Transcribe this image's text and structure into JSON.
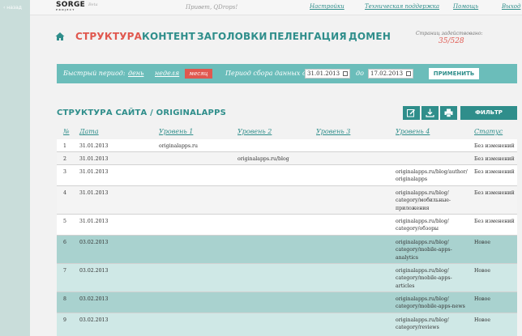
{
  "top": {
    "back_label": "‹ назад",
    "logo_main": "SORGE",
    "logo_sub": "PROJECT",
    "logo_tag": "Beta",
    "greeting": "Привет, QDrops!",
    "links": [
      "Настройки",
      "Техническая поддержка",
      "Помощь",
      "Выход"
    ]
  },
  "nav": {
    "items": [
      {
        "label": "СТРУКТУРА",
        "active": true
      },
      {
        "label": "КОНТЕНТ",
        "active": false
      },
      {
        "label": "ЗАГОЛОВКИ",
        "active": false
      },
      {
        "label": "ПЕЛЕНГАЦИЯ",
        "active": false
      },
      {
        "label": "ДОМЕН",
        "active": false
      }
    ],
    "counter_label": "Страниц задействовано:",
    "counter_value": "35/528"
  },
  "filter": {
    "quick_label": "Быстрый период:",
    "day": "день",
    "week": "неделя",
    "month": "месяц",
    "period_label": "Период сбора данных с",
    "date_from": "31.01.2013",
    "to_label": "до",
    "date_to": "17.02.2013",
    "apply_label": "ПРИМЕНИТЬ"
  },
  "section": {
    "title": "СТРУКТУРА САЙТА / ORIGINALAPPS",
    "filter_label": "ФИЛЬТР"
  },
  "table": {
    "columns": [
      "№",
      "Дата",
      "Уровень 1",
      "Уровень 2",
      "Уровень 3",
      "Уровень 4",
      "Статус"
    ],
    "rows": [
      {
        "num": "1",
        "date": "31.01.2013",
        "l1": "originalapps.ru",
        "l2": "",
        "l3": "",
        "l4": "",
        "status": "Без изменений"
      },
      {
        "num": "2",
        "date": "31.01.2013",
        "l1": "",
        "l2": "originalapps.ru/blog",
        "l3": "",
        "l4": "",
        "status": "Без изменений"
      },
      {
        "num": "3",
        "date": "31.01.2013",
        "l1": "",
        "l2": "",
        "l3": "",
        "l4": "originalapps.ru/blog/author/ originalapps",
        "status": "Без изменений"
      },
      {
        "num": "4",
        "date": "31.01.2013",
        "l1": "",
        "l2": "",
        "l3": "",
        "l4": "originalapps.ru/blog/ category/мобильные- приложения",
        "status": "Без изменений"
      },
      {
        "num": "5",
        "date": "31.01.2013",
        "l1": "",
        "l2": "",
        "l3": "",
        "l4": "originalapps.ru/blog/ category/обзоры",
        "status": "Без изменений"
      },
      {
        "num": "6",
        "date": "03.02.2013",
        "l1": "",
        "l2": "",
        "l3": "",
        "l4": "originalapps.ru/blog/ category/mobile-apps- analytics",
        "status": "Новое"
      },
      {
        "num": "7",
        "date": "03.02.2013",
        "l1": "",
        "l2": "",
        "l3": "",
        "l4": "originalapps.ru/blog/ category/mobile-apps- articles",
        "status": "Новое"
      },
      {
        "num": "8",
        "date": "03.02.2013",
        "l1": "",
        "l2": "",
        "l3": "",
        "l4": "originalapps.ru/blog/ category/mobile-apps-news",
        "status": "Новое"
      },
      {
        "num": "9",
        "date": "03.02.2013",
        "l1": "",
        "l2": "",
        "l3": "",
        "l4": "originalapps.ru/blog/ category/reviews",
        "status": "Новое"
      }
    ]
  },
  "colors": {
    "accent": "#2f8e8b",
    "filter_bar": "#6bbdba",
    "active_red": "#e0584f",
    "row_new_dark": "#a9d2cf",
    "row_new_light": "#cfe8e6",
    "row_plain_a": "#ffffff",
    "row_plain_b": "#f4f4f4"
  },
  "icons": [
    "home-icon",
    "edit-icon",
    "download-icon",
    "print-icon",
    "calendar-icon"
  ]
}
